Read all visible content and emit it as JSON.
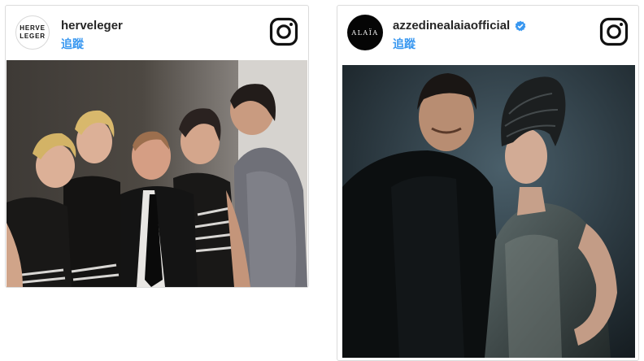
{
  "posts": [
    {
      "username": "herveleger",
      "follow_label": "追蹤",
      "avatar_logo_text": "HERVE\nLEGER",
      "verified": false,
      "platform_icon": "instagram-icon",
      "photo_subject": "herve-leger-group-photo"
    },
    {
      "username": "azzedinealaiaofficial",
      "follow_label": "追蹤",
      "avatar_logo_text": "ALAÏA",
      "verified": true,
      "verified_icon": "verified-badge-icon",
      "platform_icon": "instagram-icon",
      "photo_subject": "alaia-portrait-photo"
    }
  ],
  "colors": {
    "follow_link": "#3897f0",
    "username": "#262626",
    "border": "#dbdbdb",
    "verified": "#3897f0"
  }
}
